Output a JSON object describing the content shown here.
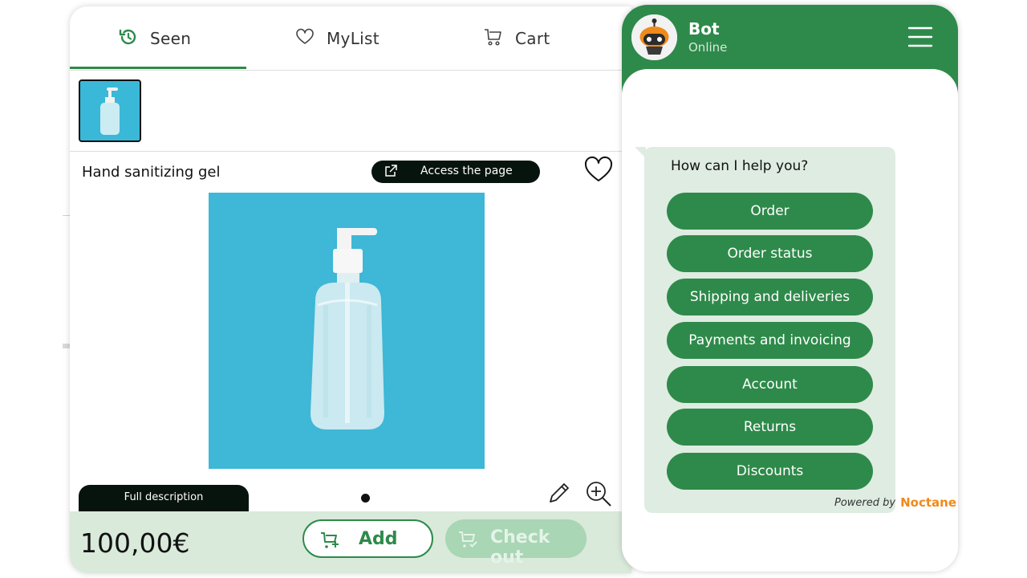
{
  "tabs": [
    {
      "label": "Seen",
      "icon": "history-icon"
    },
    {
      "label": "MyList",
      "icon": "heart-icon"
    },
    {
      "label": "Cart",
      "icon": "cart-icon"
    }
  ],
  "product": {
    "title": "Hand sanitizing gel",
    "access_label": "Access the page",
    "full_description_label": "Full description",
    "price": "100,00€",
    "add_label": "Add",
    "checkout_label": "Check out"
  },
  "chat": {
    "bot_name": "Bot",
    "status": "Online",
    "prompt": "How can I help you?",
    "options": [
      "Order",
      "Order status",
      "Shipping and deliveries",
      "Payments and invoicing",
      "Account",
      "Returns",
      "Discounts"
    ],
    "powered_by": "Powered by",
    "brand": "Noctane"
  },
  "colors": {
    "accent": "#2e8a4a",
    "bubble": "#dfece1",
    "bottom_bar": "#d9e9da",
    "brand": "#f08a1a",
    "image_bg": "#3fb7d6"
  }
}
